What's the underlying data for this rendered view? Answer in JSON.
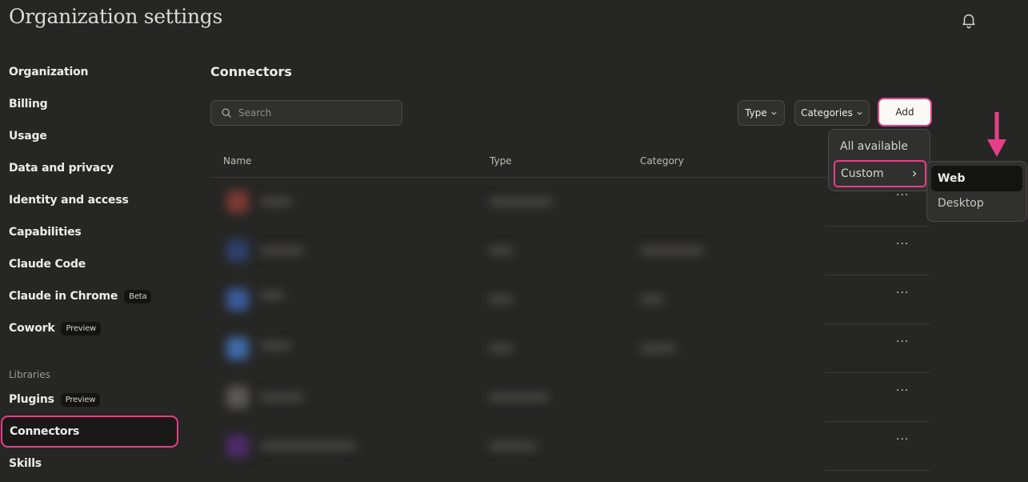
{
  "header": {
    "title": "Organization settings",
    "bell_icon": "bell-icon"
  },
  "sidebar": {
    "items": [
      {
        "label": "Organization"
      },
      {
        "label": "Billing"
      },
      {
        "label": "Usage"
      },
      {
        "label": "Data and privacy"
      },
      {
        "label": "Identity and access"
      },
      {
        "label": "Capabilities"
      },
      {
        "label": "Claude Code"
      },
      {
        "label": "Claude in Chrome",
        "badge": "Beta"
      },
      {
        "label": "Cowork",
        "badge": "Preview"
      }
    ],
    "section_label": "Libraries",
    "library_items": [
      {
        "label": "Plugins",
        "badge": "Preview"
      },
      {
        "label": "Connectors",
        "active": true
      },
      {
        "label": "Skills"
      }
    ]
  },
  "main": {
    "title": "Connectors",
    "search": {
      "placeholder": "Search",
      "value": ""
    },
    "filters": {
      "type_label": "Type",
      "categories_label": "Categories"
    },
    "add_label": "Add",
    "table": {
      "columns": [
        "Name",
        "Type",
        "Category"
      ],
      "row_action": "···"
    }
  },
  "add_menu": {
    "items": [
      "All available",
      "Custom"
    ],
    "submenu": [
      "Web",
      "Desktop"
    ]
  },
  "colors": {
    "accent": "#e63f88",
    "background": "#262624",
    "panel": "#30302e"
  }
}
